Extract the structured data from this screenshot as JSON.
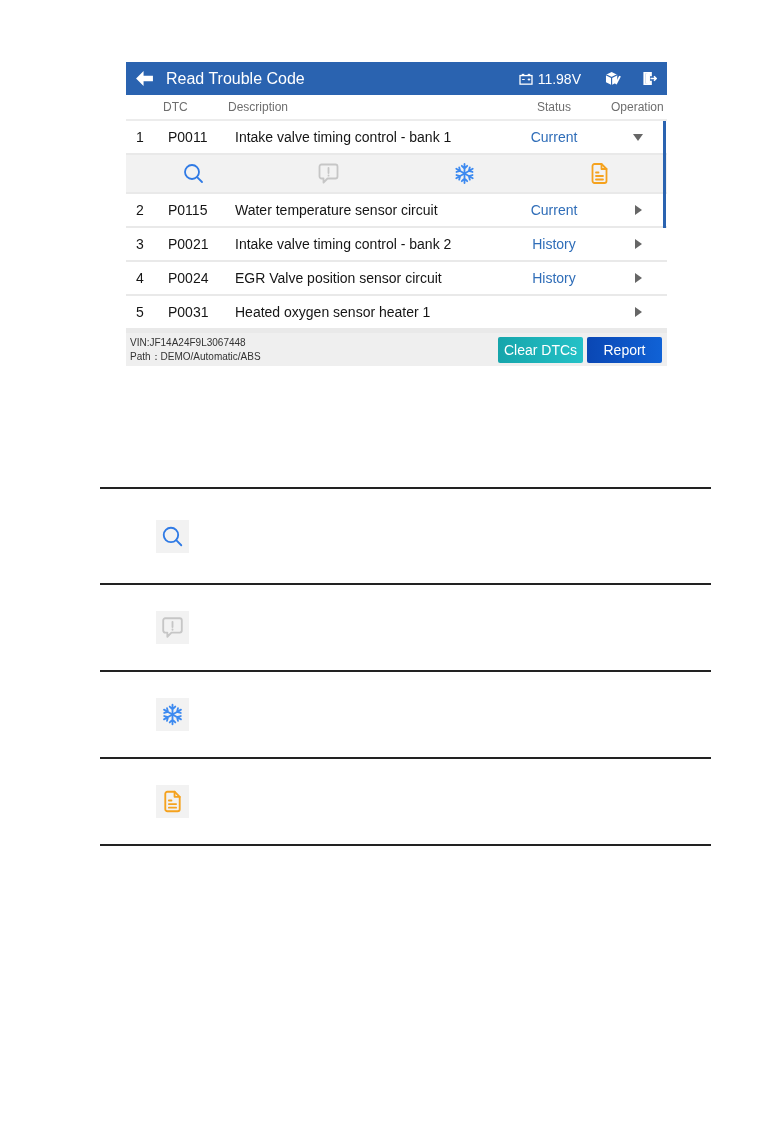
{
  "header": {
    "title": "Read Trouble Code",
    "voltage": "11.98V"
  },
  "columns": [
    "DTC",
    "Description",
    "Status",
    "Operation"
  ],
  "rows": [
    {
      "number": "1",
      "code": "P0011",
      "description": "Intake valve timing control - bank 1",
      "status": "Current",
      "expanded": true,
      "actions": [
        {
          "kind": "search",
          "disabled": false
        },
        {
          "kind": "comment",
          "disabled": true
        },
        {
          "kind": "freeze",
          "disabled": false
        },
        {
          "kind": "report",
          "disabled": false
        }
      ]
    },
    {
      "number": "2",
      "code": "P0115",
      "description": "Water temperature sensor circuit",
      "status": "Current",
      "expanded": false
    },
    {
      "number": "3",
      "code": "P0021",
      "description": "Intake valve timing control - bank 2",
      "status": "History",
      "expanded": false
    },
    {
      "number": "4",
      "code": "P0024",
      "description": "EGR Valve position sensor circuit",
      "status": "History",
      "expanded": false
    },
    {
      "number": "5",
      "code": "P0031",
      "description": "Heated oxygen sensor heater 1",
      "expanded": false
    }
  ],
  "footer": {
    "vin": "VIN:JF14A24F9L3067448",
    "path": "Path：DEMO/Automatic/ABS",
    "buttons": [
      {
        "label": "Clear DTCs",
        "kind": "clear"
      },
      {
        "label": "Report",
        "kind": "report"
      }
    ]
  },
  "legend": [
    {
      "kind": "search",
      "disabled": false
    },
    {
      "kind": "comment",
      "disabled": true
    },
    {
      "kind": "freeze",
      "disabled": false
    },
    {
      "kind": "report",
      "disabled": false
    }
  ]
}
